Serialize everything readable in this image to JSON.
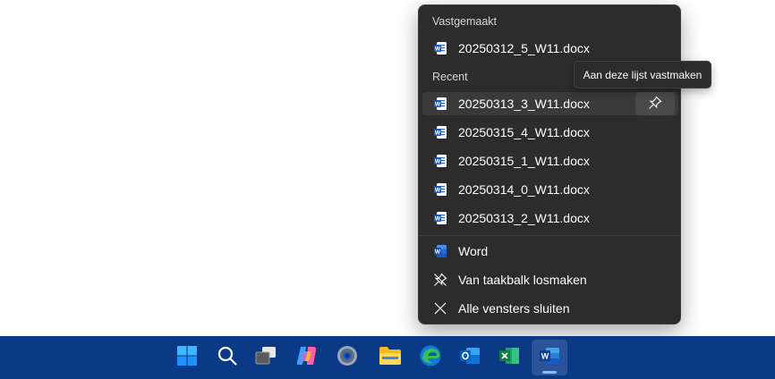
{
  "jumplist": {
    "pinned_header": "Vastgemaakt",
    "pinned": [
      {
        "label": "20250312_5_W11.docx",
        "icon": "word-doc-icon"
      }
    ],
    "recent_header": "Recent",
    "recent": [
      {
        "label": "20250313_3_W11.docx",
        "icon": "word-doc-icon"
      },
      {
        "label": "20250315_4_W11.docx",
        "icon": "word-doc-icon"
      },
      {
        "label": "20250315_1_W11.docx",
        "icon": "word-doc-icon"
      },
      {
        "label": "20250314_0_W11.docx",
        "icon": "word-doc-icon"
      },
      {
        "label": "20250313_2_W11.docx",
        "icon": "word-doc-icon"
      }
    ],
    "actions": [
      {
        "label": "Word",
        "icon": "word-app-icon"
      },
      {
        "label": "Van taakbalk losmaken",
        "icon": "unpin-icon"
      },
      {
        "label": "Alle vensters sluiten",
        "icon": "close-icon"
      }
    ]
  },
  "tooltip": {
    "text": "Aan deze lijst vastmaken"
  },
  "taskbar": {
    "background": "#0a3a86",
    "apps": [
      "start-icon",
      "search-icon",
      "task-view-icon",
      "copilot-icon",
      "settings-icon",
      "file-explorer-icon",
      "edge-icon",
      "outlook-icon",
      "excel-icon",
      "word-icon"
    ],
    "active": "word-icon"
  }
}
